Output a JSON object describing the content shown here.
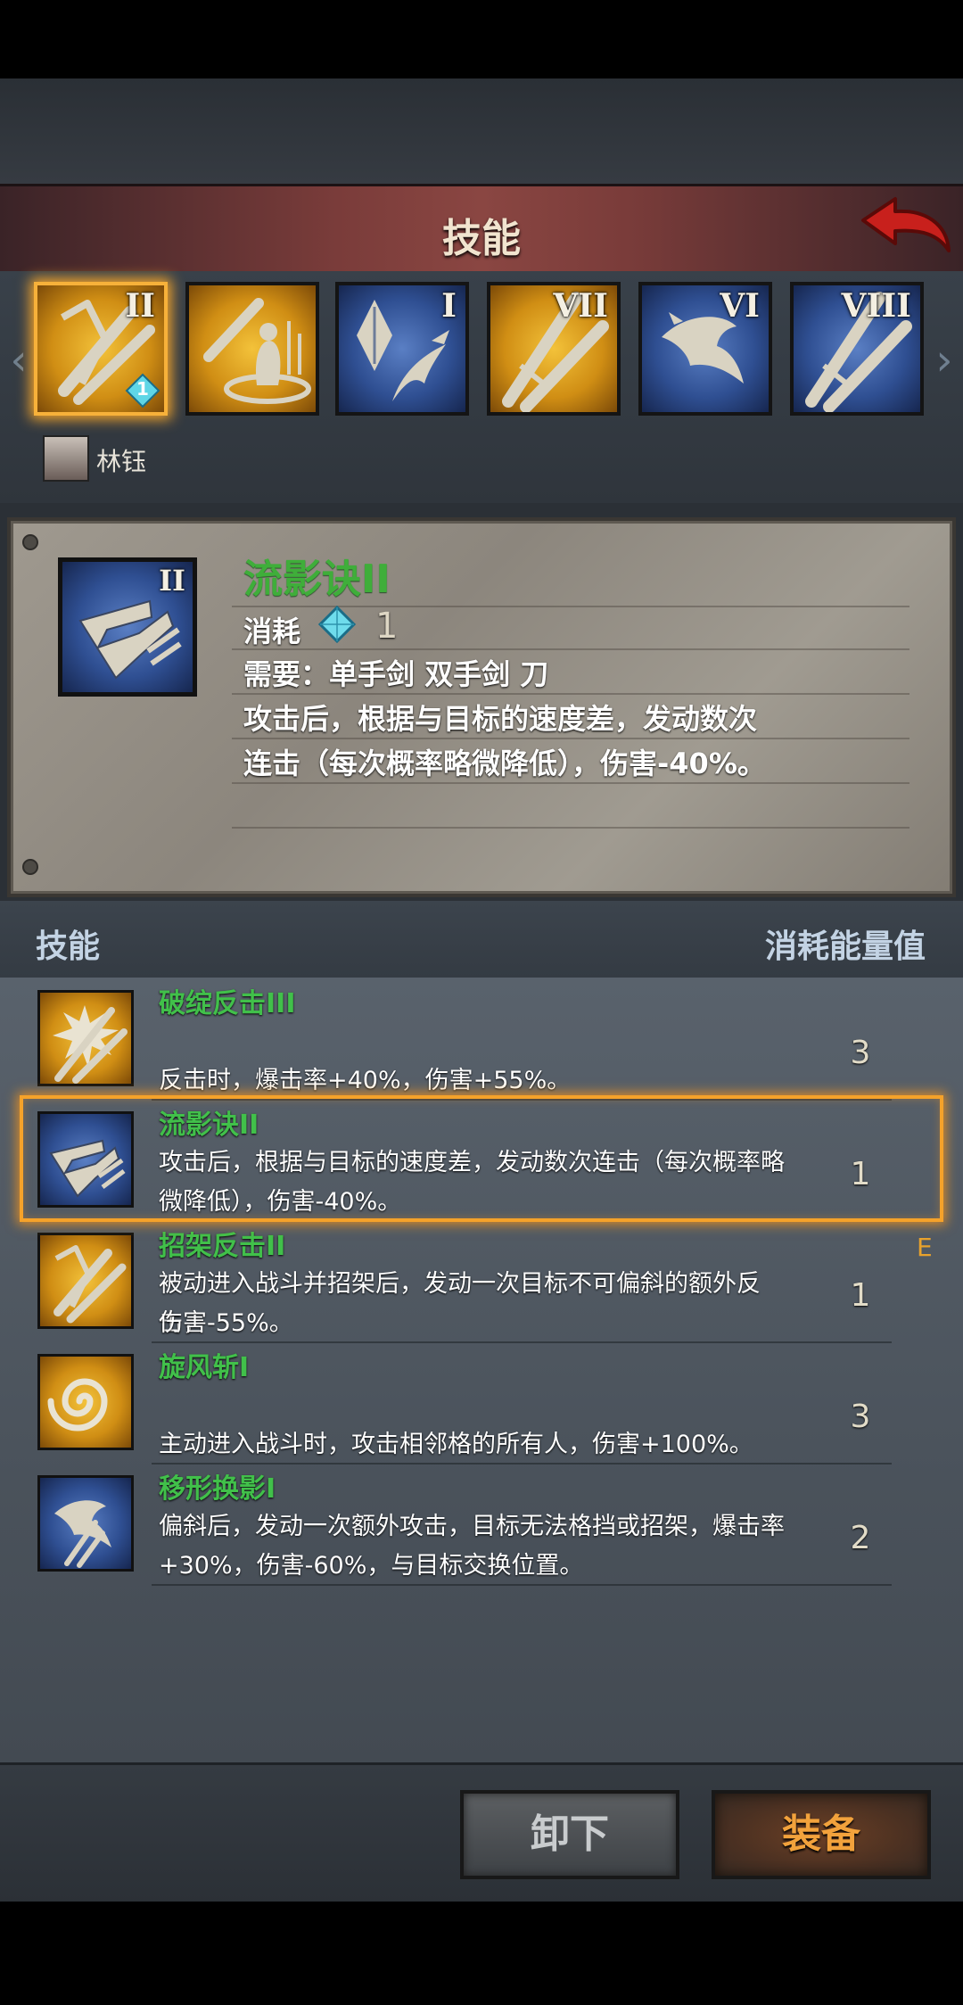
{
  "header": {
    "title": "技能"
  },
  "skill_slots": [
    {
      "roman": "II",
      "icon": "parry-counter-icon",
      "color": "gold",
      "selected": true,
      "gem_count": "1"
    },
    {
      "roman": "",
      "icon": "whirl-stance-icon",
      "color": "gold",
      "selected": false
    },
    {
      "roman": "I",
      "icon": "crystal-bird-icon",
      "color": "blue",
      "selected": false
    },
    {
      "roman": "VII",
      "icon": "crossed-swords-icon",
      "color": "gold",
      "selected": false
    },
    {
      "roman": "VI",
      "icon": "feather-icon",
      "color": "blue",
      "selected": false
    },
    {
      "roman": "VIII",
      "icon": "crossed-swords-icon",
      "color": "blue",
      "selected": false
    }
  ],
  "character": {
    "name": "林钰"
  },
  "detail": {
    "name": "流影诀II",
    "cost_label": "消耗",
    "cost_value": "1",
    "requirement": "需要：单手剑  双手剑  刀",
    "description_line1": "攻击后，根据与目标的速度差，发动数次",
    "description_line2": "连击（每次概率略微降低），伤害-40%。"
  },
  "list_header": {
    "left": "技能",
    "right": "消耗能量值"
  },
  "skills": [
    {
      "name": "破绽反击III",
      "line1": "",
      "line2": "反击时，爆击率+40%，伤害+55%。",
      "cost": "3",
      "color": "gold",
      "icon": "burst-counter-icon"
    },
    {
      "name": "流影诀II",
      "line1": "攻击后，根据与目标的速度差，发动数次连击（每次概率略",
      "line2": "微降低），伤害-40%。",
      "cost": "1",
      "color": "blue",
      "icon": "shadow-slash-icon"
    },
    {
      "name": "招架反击II",
      "line1": "被动进入战斗并招架后，发动一次目标不可偏斜的额外反击，",
      "line2": "伤害-55%。",
      "cost": "1",
      "color": "gold",
      "icon": "parry-counter-icon"
    },
    {
      "name": "旋风斩I",
      "line1": "",
      "line2": "主动进入战斗时，攻击相邻格的所有人，伤害+100%。",
      "cost": "3",
      "color": "gold",
      "icon": "whirlwind-icon"
    },
    {
      "name": "移形换影I",
      "line1": "偏斜后，发动一次额外攻击，目标无法格挡或招架，爆击率",
      "line2": "+30%，伤害-60%，与目标交换位置。",
      "cost": "2",
      "color": "blue",
      "icon": "blink-icon"
    }
  ],
  "equipped_marker": "E",
  "buttons": {
    "unequip": "卸下",
    "equip": "装备"
  }
}
